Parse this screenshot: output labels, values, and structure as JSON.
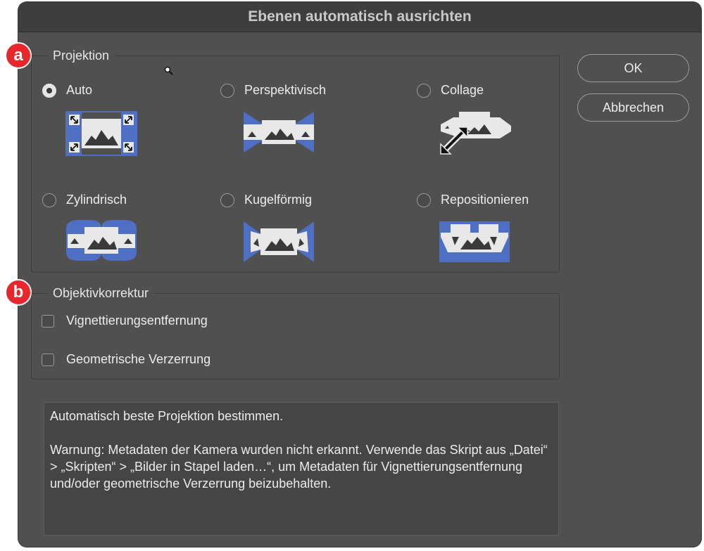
{
  "dialog": {
    "title": "Ebenen automatisch ausrichten"
  },
  "markers": {
    "a": "a",
    "b": "b"
  },
  "projection": {
    "legend": "Projektion",
    "selected": "Auto",
    "options": [
      {
        "label": "Auto",
        "icon": "auto-projection-icon"
      },
      {
        "label": "Perspektivisch",
        "icon": "perspective-projection-icon"
      },
      {
        "label": "Collage",
        "icon": "collage-projection-icon"
      },
      {
        "label": "Zylindrisch",
        "icon": "cylindrical-projection-icon"
      },
      {
        "label": "Kugelförmig",
        "icon": "spherical-projection-icon"
      },
      {
        "label": "Repositionieren",
        "icon": "reposition-projection-icon"
      }
    ]
  },
  "lens_correction": {
    "legend": "Objektivkorrektur",
    "vignette_label": "Vignettierungsentfernung",
    "vignette_checked": false,
    "geometric_label": "Geometrische Verzerrung",
    "geometric_checked": false
  },
  "buttons": {
    "ok": "OK",
    "cancel": "Abbrechen"
  },
  "info": {
    "line1": "Automatisch beste Projektion bestimmen.",
    "line2": "Warnung: Metadaten der Kamera wurden nicht erkannt. Verwende das Skript aus „Datei“ > „Skripten“ > „Bilder in Stapel laden…“, um Metadaten für Vignettierungsentfernung und/oder geometrische Verzerrung beizubehalten."
  },
  "colors": {
    "dialog_bg": "#505050",
    "accent_blue": "#4f6fc4",
    "icon_light": "#e8e8e8",
    "marker_red": "#e8262b"
  }
}
